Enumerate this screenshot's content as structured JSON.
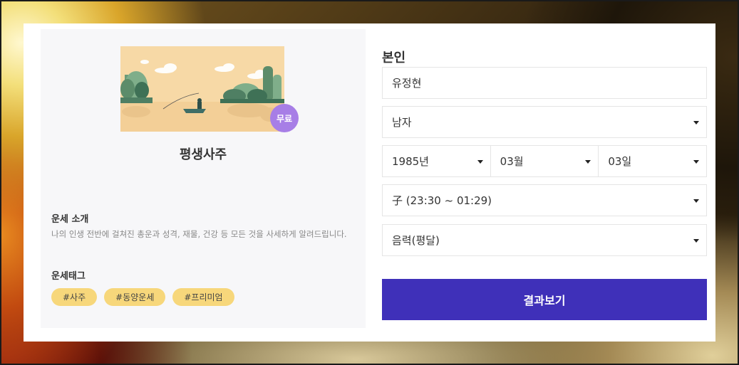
{
  "product": {
    "title": "평생사주",
    "badge": "무료",
    "intro_title": "운세 소개",
    "intro_desc": "나의 인생 전반에 걸쳐진 총운과 성격, 재물, 건강 등 모든 것을 사세하게 알려드립니다.",
    "tags_title": "운세태그",
    "tags": [
      "#사주",
      "#동양운세",
      "#프리미엄"
    ]
  },
  "form": {
    "section_title": "본인",
    "name_value": "유정현",
    "gender_value": "남자",
    "year_value": "1985년",
    "month_value": "03월",
    "day_value": "03일",
    "hour_value": "子 (23:30 ~ 01:29)",
    "calendar_value": "음력(평달)",
    "submit_label": "결과보기"
  },
  "colors": {
    "accent": "#3f30b9",
    "badge": "#a77ee6",
    "tag": "#f7d77b"
  },
  "icons": [
    "chevron-down-icon"
  ]
}
